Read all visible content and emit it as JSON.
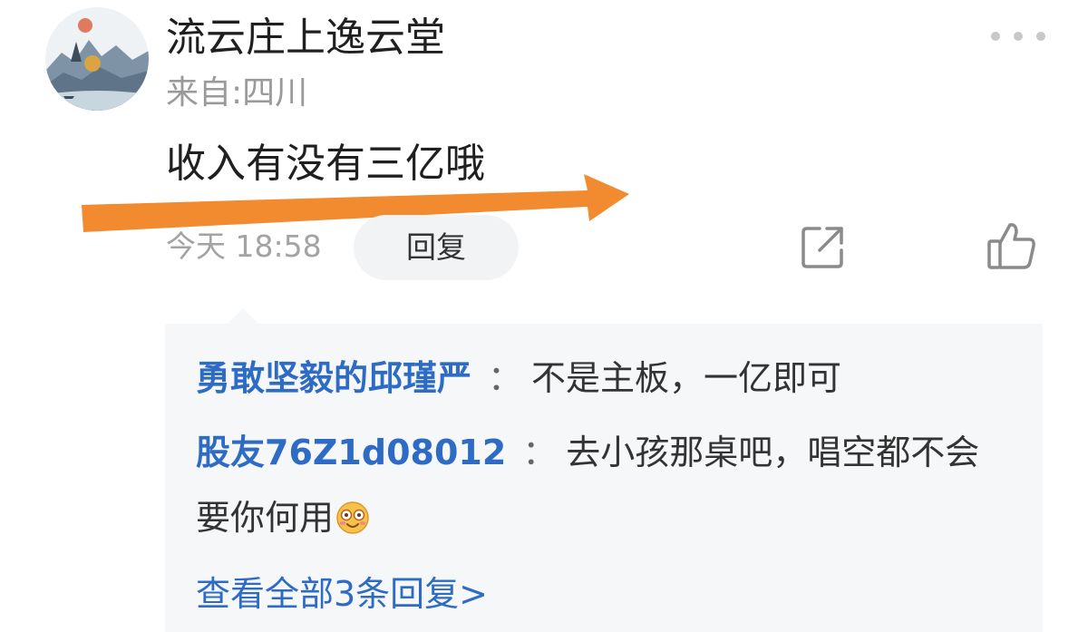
{
  "post": {
    "username": "流云庄上逸云堂",
    "location": "来自:四川",
    "content": "收入有没有三亿哦",
    "time": "今天 18:58",
    "reply_label": "回复"
  },
  "actions": {
    "more_icon": "more-icon",
    "share_icon": "share-icon",
    "like_icon": "like-icon"
  },
  "replies": [
    {
      "author": "勇敢坚毅的邱瑾严",
      "separator": "：",
      "text": "不是主板，一亿即可"
    },
    {
      "author": "股友76Z1d08012",
      "separator": "：",
      "text": "去小孩那桌吧，唱空都不会",
      "text_continued": "要你何用",
      "emoji": "smiling-face-emoji"
    }
  ],
  "view_all": "查看全部3条回复>",
  "colors": {
    "link_blue": "#2d6bc4",
    "arrow_orange": "#f28a30",
    "reply_bg": "#f6f7f9",
    "muted_gray": "#9a9a9a"
  }
}
